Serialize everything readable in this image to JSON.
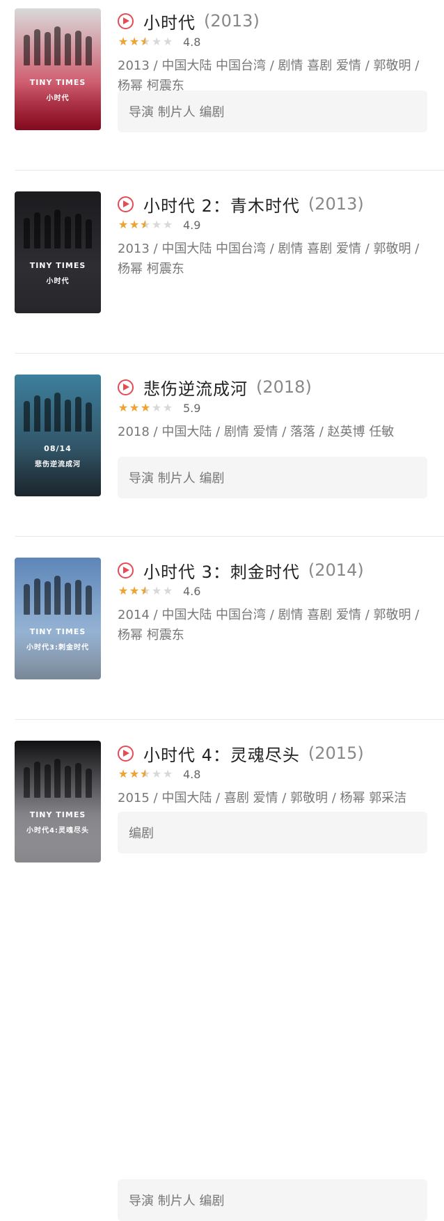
{
  "movies": [
    {
      "title": "小时代",
      "year": "(2013)",
      "rating": "4.8",
      "stars_filled": 2.5,
      "meta": "2013 / 中国大陆 中国台湾 / 剧情 喜剧 爱情 / 郭敬明 / 杨幂 柯震东",
      "credits": "导演 制片人 编剧",
      "poster_text": "TINY TIMES",
      "poster_sub": "小时代",
      "poster_colors": [
        "#d9d9d9",
        "#c8102e"
      ]
    },
    {
      "title": "小时代 2：青木时代",
      "year": "(2013)",
      "rating": "4.9",
      "stars_filled": 2.5,
      "meta": "2013 / 中国大陆 中国台湾 / 剧情 喜剧 爱情 / 郭敬明 / 杨幂 柯震东",
      "credits": "导演 制片人 编剧",
      "poster_text": "TINY TIMES",
      "poster_sub": "小时代",
      "poster_colors": [
        "#1b1b1e",
        "#3a3a3f"
      ]
    },
    {
      "title": "悲伤逆流成河",
      "year": "(2018)",
      "rating": "5.9",
      "stars_filled": 3,
      "meta": "2018 / 中国大陆 / 剧情 爱情 / 落落 / 赵英博 任敏",
      "credits": "编剧",
      "poster_text": "08/14",
      "poster_sub": "悲伤逆流成河",
      "poster_colors": [
        "#3d7f9c",
        "#2a3a45"
      ]
    },
    {
      "title": "小时代 3：刺金时代",
      "year": "(2014)",
      "rating": "4.6",
      "stars_filled": 2.5,
      "meta": "2014 / 中国大陆 中国台湾 / 剧情 喜剧 爱情 / 郭敬明 / 杨幂 柯震东",
      "credits": "导演 制片人 编剧",
      "poster_text": "TINY TIMES",
      "poster_sub": "小时代3:刺金时代",
      "poster_colors": [
        "#5d86b8",
        "#b9cfe6"
      ]
    },
    {
      "title": "小时代 4：灵魂尽头",
      "year": "(2015)",
      "rating": "4.8",
      "stars_filled": 2.5,
      "meta": "2015 / 中国大陆 / 喜剧 爱情 / 郭敬明 / 杨幂 郭采洁",
      "credits": "",
      "poster_text": "TINY TIMES",
      "poster_sub": "小时代4:灵魂尽头",
      "poster_colors": [
        "#111114",
        "#cfcfd4"
      ]
    }
  ],
  "colors": {
    "accent": "#e64b55",
    "star": "#f0a22e",
    "star_empty": "#d8d8d8"
  },
  "icons": {
    "play": "play-circle-icon",
    "star": "star-icon"
  }
}
